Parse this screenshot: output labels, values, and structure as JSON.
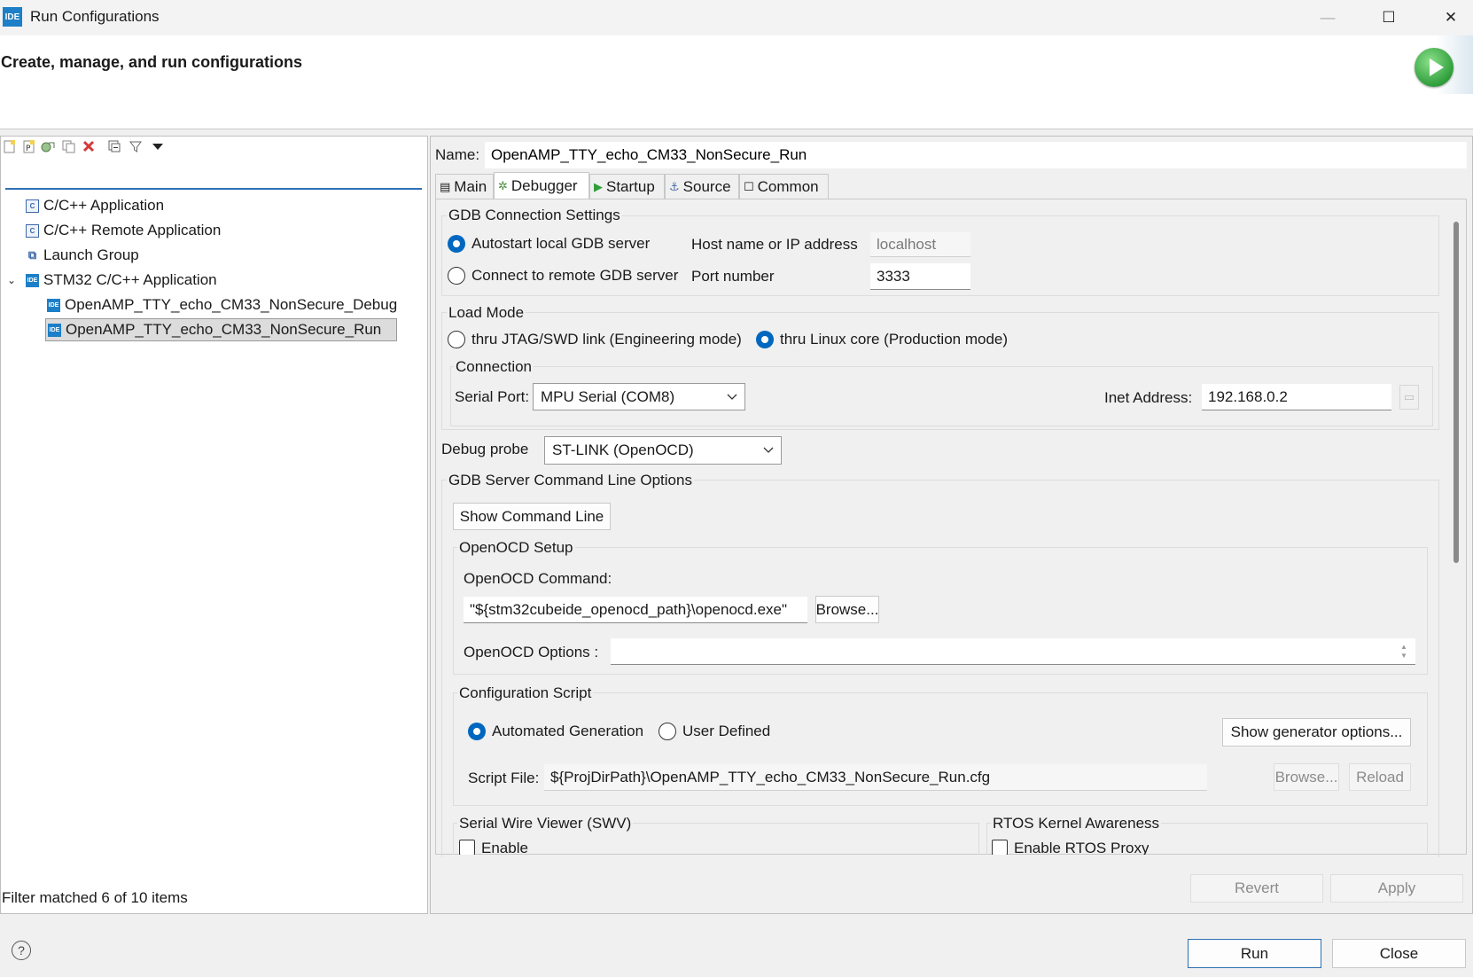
{
  "window": {
    "app_icon_text": "IDE",
    "title": "Run Configurations",
    "minimize_glyph": "—",
    "maximize_glyph": "☐",
    "close_glyph": "✕"
  },
  "header": {
    "title": "Create, manage, and run configurations",
    "logo_icon": "run-icon"
  },
  "left_toolbar": {
    "icons": [
      "new-config-icon",
      "new-prototype-icon",
      "export-icon",
      "duplicate-icon",
      "delete-icon",
      "collapse-all-icon",
      "filter-icon",
      "view-menu-icon"
    ]
  },
  "filter": {
    "value": ""
  },
  "tree": [
    {
      "label": "C/C++ Application",
      "icon": "c-app-icon",
      "level": 0
    },
    {
      "label": "C/C++ Remote Application",
      "icon": "c-app-icon",
      "level": 0
    },
    {
      "label": "Launch Group",
      "icon": "launch-group-icon",
      "level": 0
    },
    {
      "label": "STM32 C/C++ Application",
      "icon": "ide-icon",
      "level": 0,
      "expanded": true
    },
    {
      "label": "OpenAMP_TTY_echo_CM33_NonSecure_Debug",
      "icon": "ide-icon",
      "level": 1
    },
    {
      "label": "OpenAMP_TTY_echo_CM33_NonSecure_Run",
      "icon": "ide-icon",
      "level": 1,
      "selected": true
    }
  ],
  "filter_status": "Filter matched 6 of 10 items",
  "config": {
    "name_label": "Name:",
    "name_value": "OpenAMP_TTY_echo_CM33_NonSecure_Run",
    "tabs": [
      {
        "label": "Main",
        "icon": "main-tab-icon"
      },
      {
        "label": "Debugger",
        "icon": "debugger-tab-icon",
        "active": true
      },
      {
        "label": "Startup",
        "icon": "startup-tab-icon"
      },
      {
        "label": "Source",
        "icon": "source-tab-icon"
      },
      {
        "label": "Common",
        "icon": "common-tab-icon"
      }
    ]
  },
  "debugger": {
    "gdb_group": "GDB Connection Settings",
    "autostart_label": "Autostart local GDB server",
    "remote_label": "Connect to remote GDB server",
    "host_label": "Host name or IP address",
    "host_value": "localhost",
    "port_label": "Port number",
    "port_value": "3333",
    "load_mode_group": "Load Mode",
    "jtag_label": "thru JTAG/SWD link (Engineering mode)",
    "linux_label": "thru Linux core (Production mode)",
    "connection_group": "Connection",
    "serial_port_label": "Serial Port:",
    "serial_port_value": "MPU Serial (COM8)",
    "inet_label": "Inet Address:",
    "inet_value": "192.168.0.2",
    "debug_probe_label": "Debug probe",
    "debug_probe_value": "ST-LINK (OpenOCD)",
    "gdb_server_group": "GDB Server Command Line Options",
    "show_cmd_button": "Show Command Line",
    "openocd_group": "OpenOCD Setup",
    "openocd_cmd_label": "OpenOCD Command:",
    "openocd_cmd_value": "\"${stm32cubeide_openocd_path}\\openocd.exe\"",
    "browse_label": "Browse...",
    "openocd_options_label": "OpenOCD Options :",
    "openocd_options_value": "",
    "config_script_group": "Configuration Script",
    "automated_label": "Automated Generation",
    "user_defined_label": "User Defined",
    "show_generator_button": "Show generator options...",
    "script_file_label": "Script File:",
    "script_file_value": "${ProjDirPath}\\OpenAMP_TTY_echo_CM33_NonSecure_Run.cfg",
    "script_browse_label": "Browse...",
    "reload_label": "Reload",
    "swv_group": "Serial Wire Viewer (SWV)",
    "swv_enable_label": "Enable",
    "rtos_group": "RTOS Kernel Awareness",
    "rtos_enable_label": "Enable RTOS Proxy"
  },
  "actions": {
    "revert": "Revert",
    "apply": "Apply",
    "run": "Run",
    "close": "Close",
    "help_glyph": "?"
  }
}
